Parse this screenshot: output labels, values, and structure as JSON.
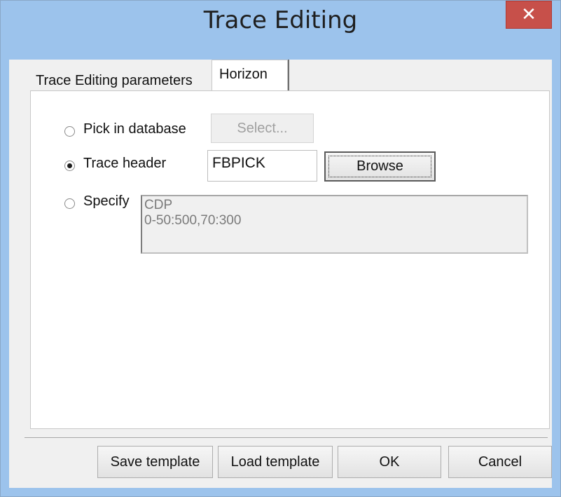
{
  "window": {
    "title": "Trace Editing",
    "close_symbol": "✕"
  },
  "tabs": [
    {
      "label": "Trace Editing parameters",
      "active": false
    },
    {
      "label": "Horizon",
      "active": true
    }
  ],
  "horizon": {
    "options": [
      {
        "label": "Pick in database",
        "checked": false,
        "button_label": "Select...",
        "button_enabled": false
      },
      {
        "label": "Trace header",
        "checked": true,
        "value": "FBPICK",
        "button_label": "Browse"
      },
      {
        "label": "Specify",
        "checked": false,
        "text": "CDP\n0-50:500,70:300"
      }
    ]
  },
  "footer": {
    "save_template": "Save template",
    "load_template": "Load template",
    "ok": "OK",
    "cancel": "Cancel"
  }
}
